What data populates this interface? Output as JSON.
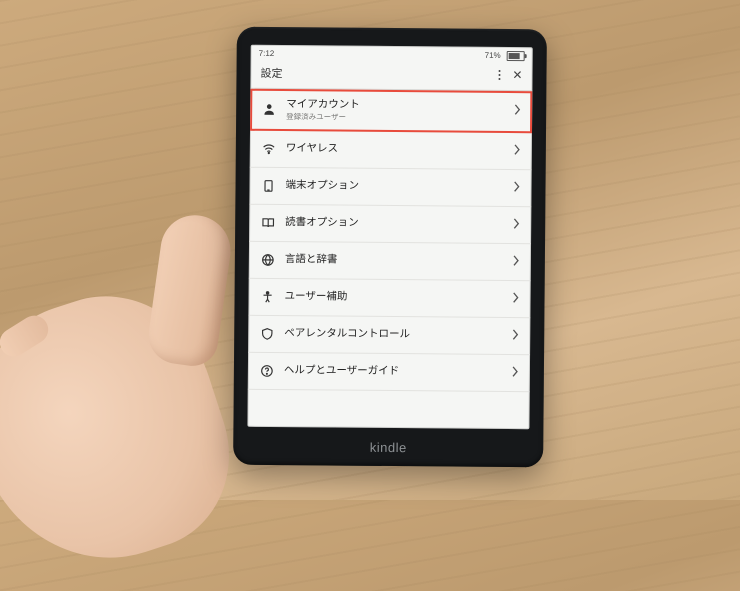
{
  "device_brand": "kindle",
  "status": {
    "time": "7:12",
    "battery_pct": "71%"
  },
  "header": {
    "title": "設定"
  },
  "settings": [
    {
      "icon": "user-icon",
      "label": "マイアカウント",
      "sub": "登録済みユーザー",
      "highlight": true
    },
    {
      "icon": "wifi-icon",
      "label": "ワイヤレス"
    },
    {
      "icon": "device-icon",
      "label": "端末オプション"
    },
    {
      "icon": "book-icon",
      "label": "読書オプション"
    },
    {
      "icon": "globe-icon",
      "label": "言語と辞書"
    },
    {
      "icon": "accessibility-icon",
      "label": "ユーザー補助"
    },
    {
      "icon": "shield-icon",
      "label": "ペアレンタルコントロール"
    },
    {
      "icon": "help-icon",
      "label": "ヘルプとユーザーガイド"
    }
  ]
}
